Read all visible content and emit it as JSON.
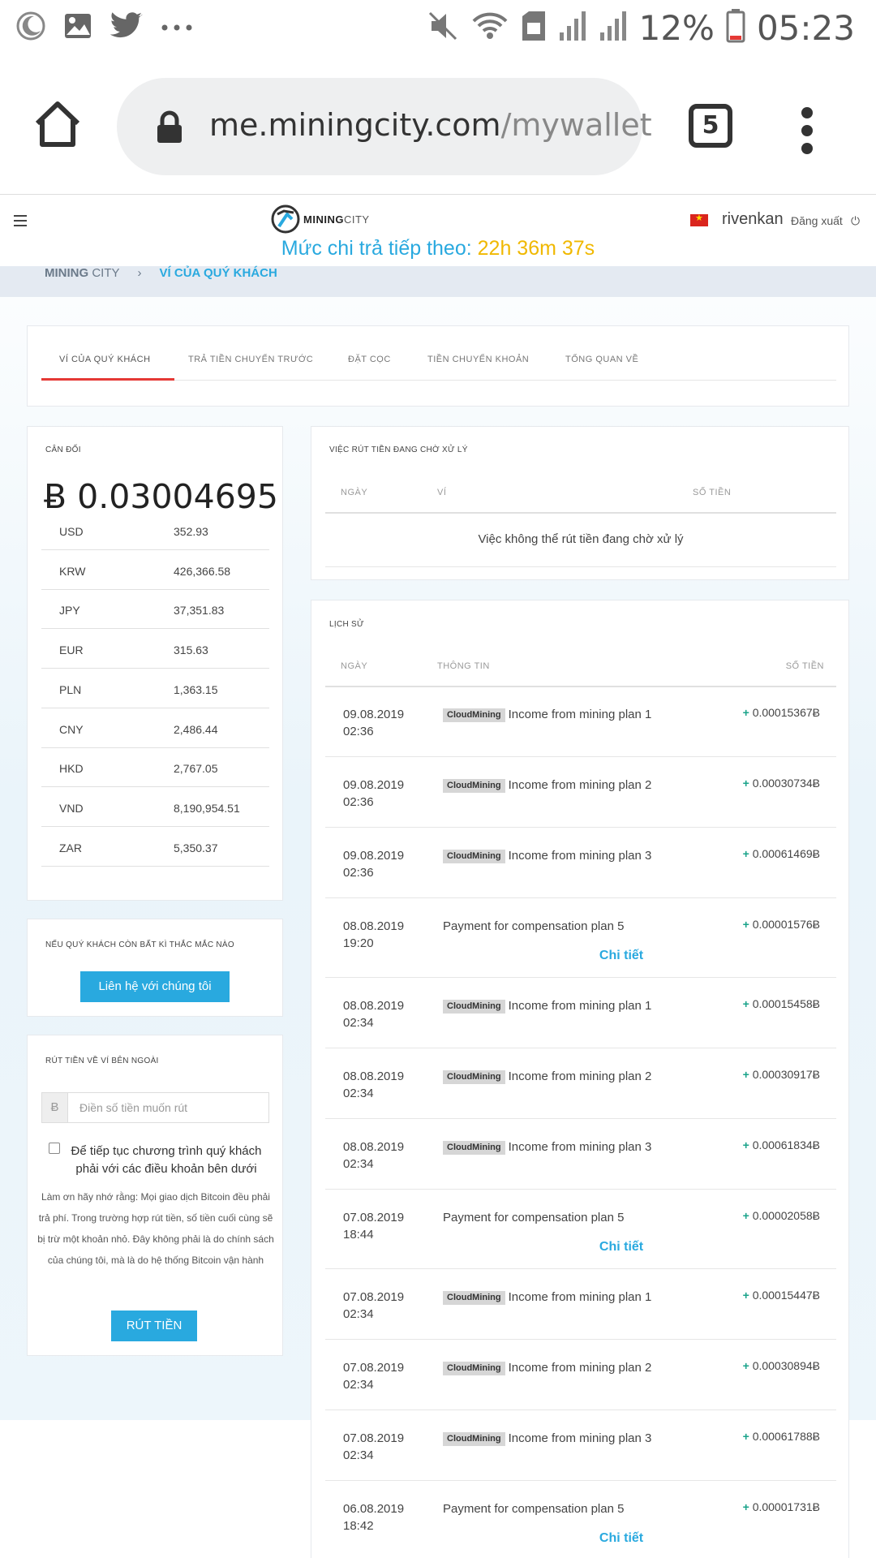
{
  "statusbar": {
    "battery": "12%",
    "time": "05:23"
  },
  "browser": {
    "url_host": "me.miningcity.com",
    "url_path": "/mywallet",
    "tab_count": "5"
  },
  "site": {
    "logo_mining": "MINING",
    "logo_city": "CITY",
    "username": "rivenkan",
    "logout": "Đăng xuất",
    "payout_label": "Mức chi trả tiếp theo: ",
    "payout_time": "22h 36m 37s"
  },
  "breadcrumb": {
    "mining": "MINING",
    "city": "CITY",
    "separator": "›",
    "current": "VÍ CỦA QUÝ KHÁCH"
  },
  "tabs": [
    {
      "label": "VÍ CỦA QUÝ KHÁCH"
    },
    {
      "label": "TRẢ TIỀN CHUYỂN TRƯỚC"
    },
    {
      "label": "ĐẶT CỌC"
    },
    {
      "label": "TIỀN CHUYỂN KHOẢN"
    },
    {
      "label": "TỔNG QUAN VỀ"
    }
  ],
  "balance": {
    "title": "CÂN ĐỐI",
    "amount": "Ƀ 0.03004695",
    "currencies": [
      {
        "code": "USD",
        "value": "352.93"
      },
      {
        "code": "KRW",
        "value": "426,366.58"
      },
      {
        "code": "JPY",
        "value": "37,351.83"
      },
      {
        "code": "EUR",
        "value": "315.63"
      },
      {
        "code": "PLN",
        "value": "1,363.15"
      },
      {
        "code": "CNY",
        "value": "2,486.44"
      },
      {
        "code": "HKD",
        "value": "2,767.05"
      },
      {
        "code": "VND",
        "value": "8,190,954.51"
      },
      {
        "code": "ZAR",
        "value": "5,350.37"
      }
    ]
  },
  "contact": {
    "title": "NẾU QUÝ KHÁCH CÒN BẤT KÌ THẮC MẮC NÀO",
    "button": "Liên hệ với chúng tôi"
  },
  "withdraw": {
    "title": "RÚT TIỀN VỀ VÍ BÊN NGOÀI",
    "currency_symbol": "Ƀ",
    "placeholder": "Điền số tiền muốn rút",
    "terms": "Để tiếp tục chương trình quý khách phải với các điều khoản bên dưới",
    "note": "Làm ơn hãy nhớ rằng: Mọi giao dịch Bitcoin đều phải trả phí. Trong trường hợp rút tiền, số tiền cuối cùng sẽ bị trừ một khoản nhỏ. Đây không phải là do chính sách của chúng tôi, mà là do hệ thống Bitcoin vận hành",
    "button": "RÚT TIỀN"
  },
  "pending": {
    "title": "VIỆC RÚT TIỀN ĐANG CHỜ XỬ LÝ",
    "col_date": "NGÀY",
    "col_wallet": "VÍ",
    "col_amount": "SỐ TIỀN",
    "empty": "Việc không thể rút tiền đang chờ xử lý"
  },
  "history": {
    "title": "LỊCH SỬ",
    "col_date": "NGÀY",
    "col_info": "THÔNG TIN",
    "col_amount": "SỐ TIỀN",
    "detail_label": "Chi tiết",
    "rows": [
      {
        "date": "09.08.2019",
        "time": "02:36",
        "badge": "CloudMining",
        "info": "Income from mining plan 1",
        "amount": "0.00015367Ƀ",
        "detail": ""
      },
      {
        "date": "09.08.2019",
        "time": "02:36",
        "badge": "CloudMining",
        "info": "Income from mining plan 2",
        "amount": "0.00030734Ƀ",
        "detail": ""
      },
      {
        "date": "09.08.2019",
        "time": "02:36",
        "badge": "CloudMining",
        "info": "Income from mining plan 3",
        "amount": "0.00061469Ƀ",
        "detail": ""
      },
      {
        "date": "08.08.2019",
        "time": "19:20",
        "badge": "",
        "info": "Payment for compensation plan 5",
        "amount": "0.00001576Ƀ",
        "detail": "Chi tiết"
      },
      {
        "date": "08.08.2019",
        "time": "02:34",
        "badge": "CloudMining",
        "info": "Income from mining plan 1",
        "amount": "0.00015458Ƀ",
        "detail": ""
      },
      {
        "date": "08.08.2019",
        "time": "02:34",
        "badge": "CloudMining",
        "info": "Income from mining plan 2",
        "amount": "0.00030917Ƀ",
        "detail": ""
      },
      {
        "date": "08.08.2019",
        "time": "02:34",
        "badge": "CloudMining",
        "info": "Income from mining plan 3",
        "amount": "0.00061834Ƀ",
        "detail": ""
      },
      {
        "date": "07.08.2019",
        "time": "18:44",
        "badge": "",
        "info": "Payment for compensation plan 5",
        "amount": "0.00002058Ƀ",
        "detail": "Chi tiết"
      },
      {
        "date": "07.08.2019",
        "time": "02:34",
        "badge": "CloudMining",
        "info": "Income from mining plan 1",
        "amount": "0.00015447Ƀ",
        "detail": ""
      },
      {
        "date": "07.08.2019",
        "time": "02:34",
        "badge": "CloudMining",
        "info": "Income from mining plan 2",
        "amount": "0.00030894Ƀ",
        "detail": ""
      },
      {
        "date": "07.08.2019",
        "time": "02:34",
        "badge": "CloudMining",
        "info": "Income from mining plan 3",
        "amount": "0.00061788Ƀ",
        "detail": ""
      },
      {
        "date": "06.08.2019",
        "time": "18:42",
        "badge": "",
        "info": "Payment for compensation plan 5",
        "amount": "0.00001731Ƀ",
        "detail": "Chi tiết"
      }
    ]
  },
  "colors": {
    "accent_blue": "#29a9df",
    "tab_indicator": "#e53935",
    "positive_green": "#1aa38a",
    "countdown_yellow": "#f0b800"
  },
  "icons": {
    "status_left": [
      "moon-icon",
      "image-icon",
      "twitter-icon",
      "more-dots-icon"
    ],
    "status_right": [
      "mute-icon",
      "wifi-icon",
      "sim-icon",
      "signal-icon",
      "signal-icon",
      "battery-icon"
    ],
    "browser": [
      "home-icon",
      "lock-icon",
      "tabs-counter",
      "kebab-menu-icon"
    ]
  }
}
